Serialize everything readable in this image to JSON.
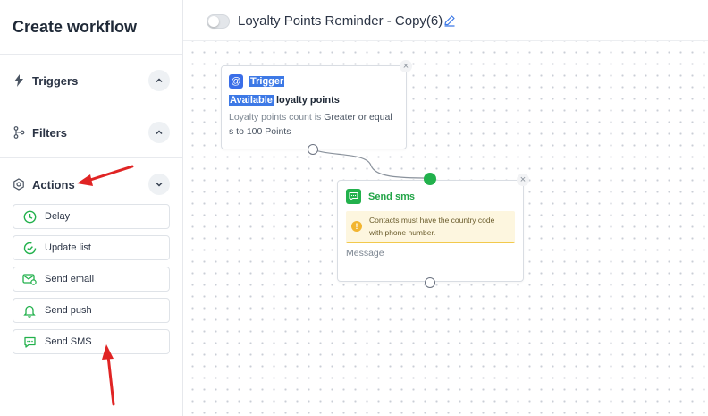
{
  "sidebar": {
    "title": "Create workflow",
    "sections": {
      "triggers": "Triggers",
      "filters": "Filters",
      "actions": "Actions"
    },
    "actions": [
      {
        "label": "Delay",
        "icon": "clock-icon"
      },
      {
        "label": "Update list",
        "icon": "list-check-icon"
      },
      {
        "label": "Send email",
        "icon": "email-icon"
      },
      {
        "label": "Send push",
        "icon": "bell-icon"
      },
      {
        "label": "Send SMS",
        "icon": "sms-icon"
      }
    ]
  },
  "header": {
    "workflow_title": "Loyalty Points Reminder - Copy(6)"
  },
  "canvas": {
    "trigger_node": {
      "header_label": "Trigger",
      "title_highlight": "Available",
      "title_rest": " loyalty points",
      "desc_pre": "Loyalty points count is ",
      "desc_op": "Greater or equal",
      "desc_post": "s to 100 Points"
    },
    "sms_node": {
      "header_label": "Send sms",
      "warning_line1": "Contacts must have the country code",
      "warning_line2": "with phone number.",
      "message_label": "Message"
    }
  },
  "colors": {
    "accent_blue": "#3a6ee8",
    "accent_green": "#22b14c",
    "annotation_red": "#e02424",
    "warning_bg": "#fdf6df"
  }
}
